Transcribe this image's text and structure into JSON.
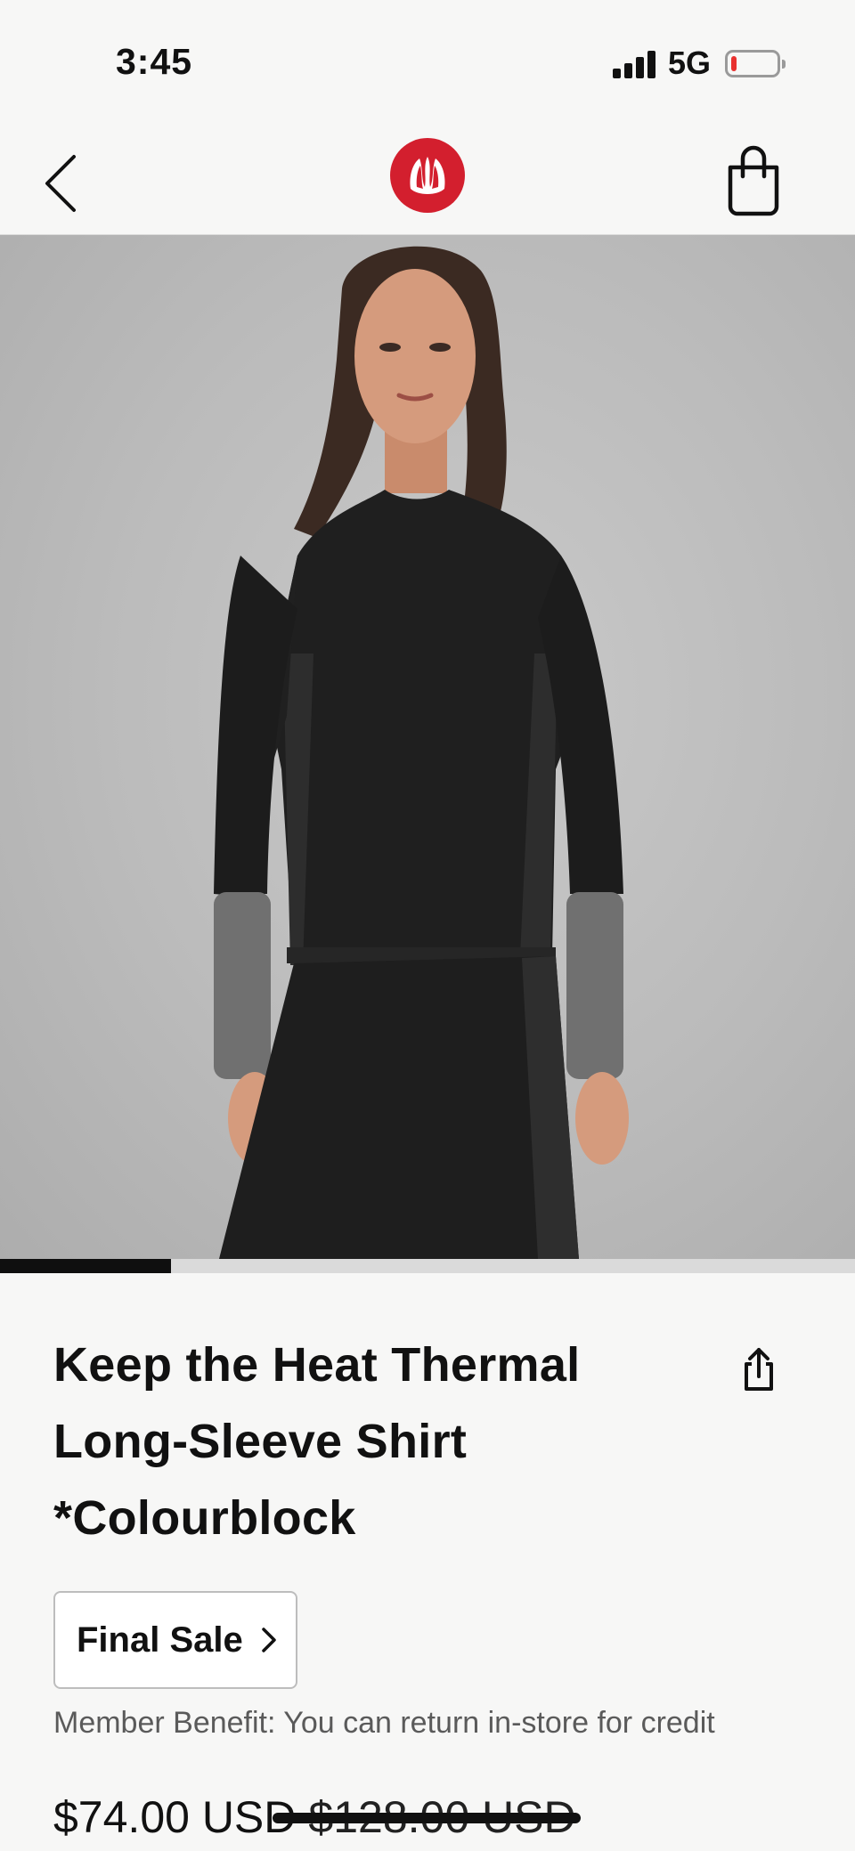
{
  "status_bar": {
    "time": "3:45",
    "network": "5G",
    "battery_level_fraction": 0.12,
    "battery_color": "#e8312f"
  },
  "nav": {
    "back_icon": "chevron-left-icon",
    "logo_icon": "lululemon-logo-icon",
    "logo_color": "#d31f2e",
    "bag_icon": "shopping-bag-icon"
  },
  "gallery": {
    "image_description_icon": "product-photo",
    "progress_fraction": 0.2
  },
  "product": {
    "title": "Keep the Heat Thermal Long-Sleeve Shirt *Colourblock",
    "share_icon": "share-icon",
    "final_sale_label": "Final Sale",
    "member_benefit": "Member Benefit: You can return in-store for credit",
    "price": "$74.00 USD",
    "original_price": "$128.00 USD"
  }
}
